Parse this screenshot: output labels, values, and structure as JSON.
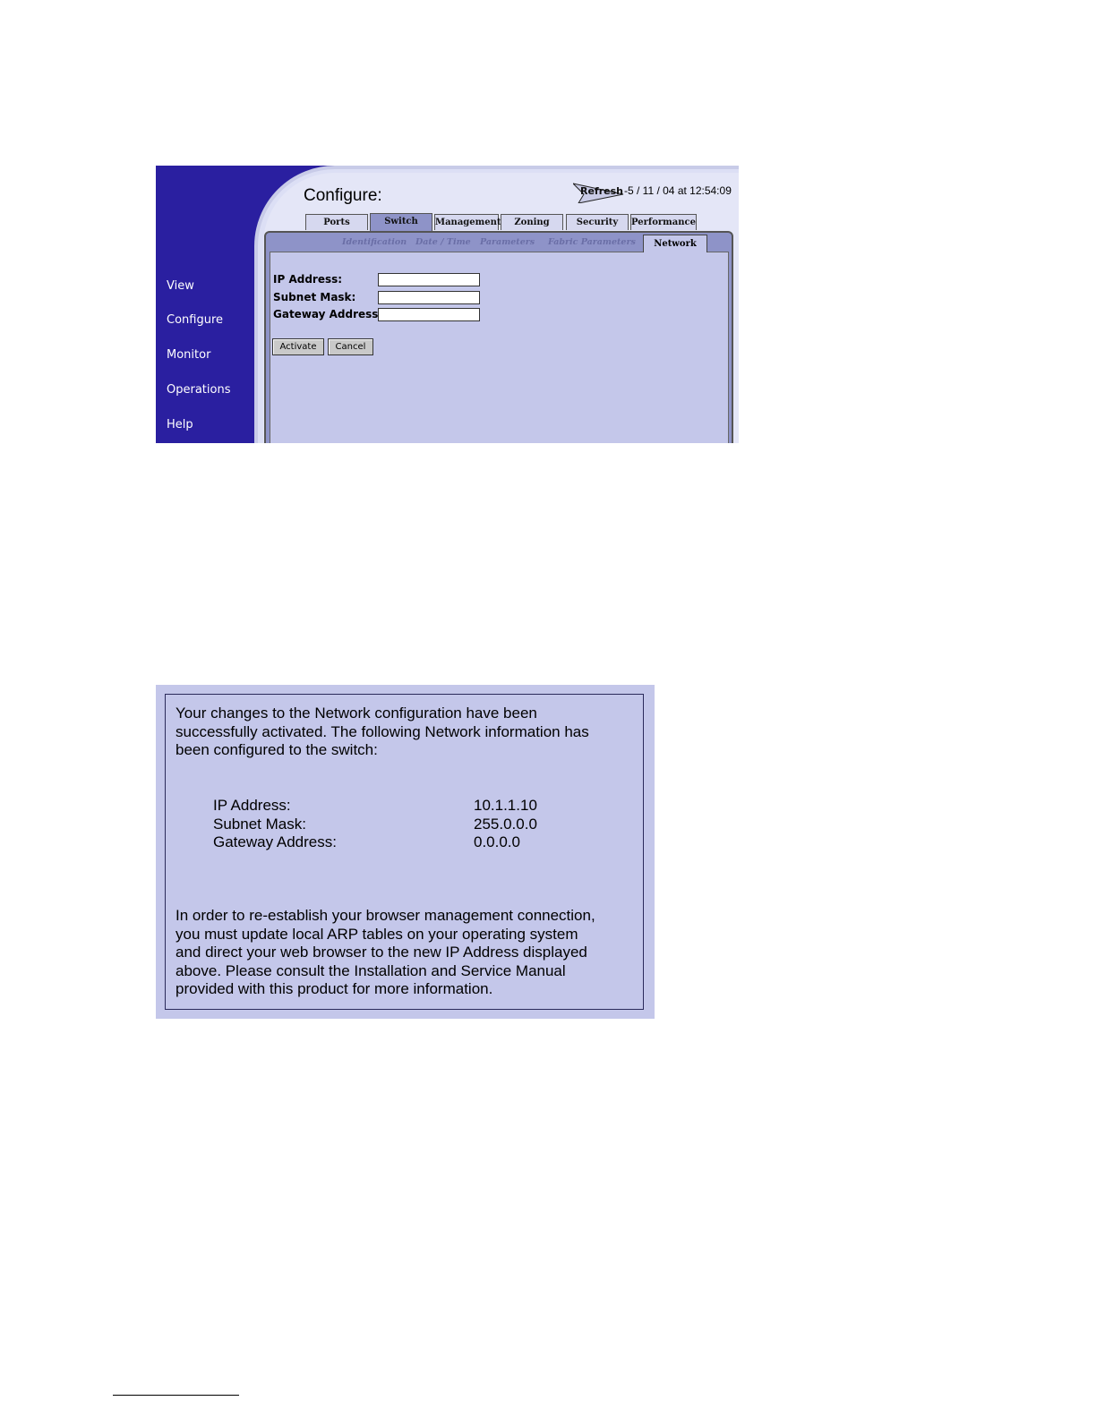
{
  "configure_window": {
    "nav": [
      "View",
      "Configure",
      "Monitor",
      "Operations",
      "Help"
    ],
    "title": "Configure:",
    "refresh_label": "Refresh",
    "refresh_time": "-5 / 11 / 04 at 12:54:09",
    "tabs": [
      "Ports",
      "Switch",
      "Management",
      "Zoning",
      "Security",
      "Performance"
    ],
    "active_tab": "Switch",
    "subtabs": [
      "Identification",
      "Date / Time",
      "Parameters",
      "Fabric Parameters",
      "Network"
    ],
    "active_subtab": "Network",
    "form": {
      "ip_label": "IP  Address:",
      "ip_value": "",
      "subnet_label": "Subnet Mask:",
      "subnet_value": "",
      "gateway_label": "Gateway Address:",
      "gateway_value": ""
    },
    "buttons": {
      "activate": "Activate",
      "cancel": "Cancel"
    }
  },
  "confirmation": {
    "intro_lines": [
      "Your changes to the Network configuration have been",
      "successfully activated.  The following Network information has",
      "been configured to the switch:"
    ],
    "info": [
      {
        "label": "IP  Address:",
        "value": "10.1.1.10"
      },
      {
        "label": "Subnet Mask:",
        "value": "255.0.0.0"
      },
      {
        "label": "Gateway Address:",
        "value": "0.0.0.0"
      }
    ],
    "outro_lines": [
      "In order to re-establish your browser management connection,",
      "you must update local ARP tables on your operating system",
      "and direct your web browser to the new IP Address displayed",
      "above.  Please consult the Installation and Service Manual",
      "provided with this product for more information."
    ]
  },
  "colors": {
    "nav_bg": "#2a1fa0",
    "panel_bg": "#c4c7ea",
    "tab_active": "#8e93c8"
  }
}
